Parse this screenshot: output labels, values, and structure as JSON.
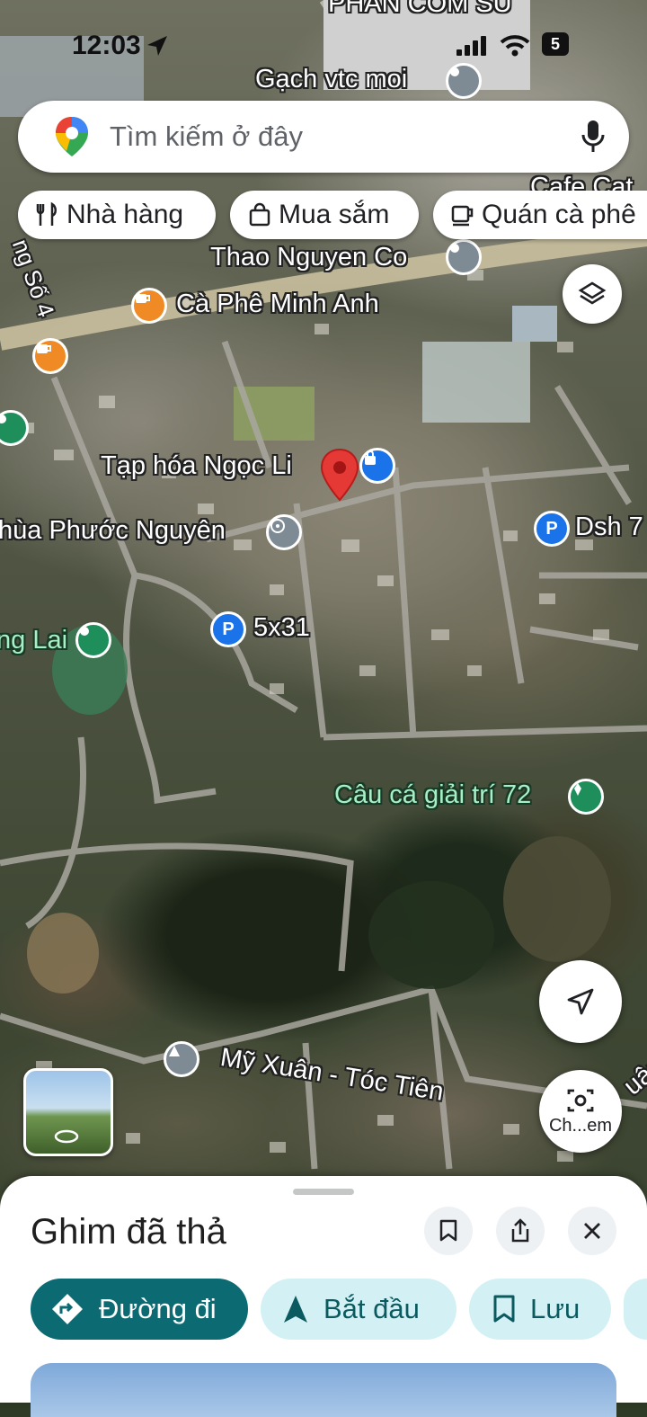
{
  "status_bar": {
    "time": "12:03",
    "battery": "5"
  },
  "search": {
    "placeholder": "Tìm kiếm ở đây"
  },
  "chips": [
    {
      "label": "Nhà hàng",
      "icon": "fork-knife-icon"
    },
    {
      "label": "Mua sắm",
      "icon": "shopping-bag-icon"
    },
    {
      "label": "Quán cà phê",
      "icon": "coffee-icon"
    }
  ],
  "map_labels": {
    "top_factory": "PHAN COM SU",
    "gach": "Gạch vtc moi",
    "cafe_cat": "Cafe Cat",
    "thao": "Thao Nguyen Co",
    "road_left": "ng Số 4",
    "minh_anh": "Cà Phê Minh Anh",
    "tap_hoa": "Tạp hóa Ngọc Li",
    "chua": "hùa Phước Nguyên",
    "dsh": "Dsh 7",
    "parking": "5x31",
    "lai": "ng Lai",
    "cau_ca": "Câu cá giải trí 72",
    "my_xuan": "Mỹ Xuân - Tóc Tiên",
    "road_right": "uân"
  },
  "controls": {
    "camera_label": "Ch...em"
  },
  "sheet": {
    "title": "Ghim đã thả",
    "directions": "Đường đi",
    "start": "Bắt đầu",
    "save": "Lưu"
  },
  "colors": {
    "accent": "#0b57d0",
    "directions_bg": "#0b6a72",
    "chip_bg": "#d3f1f4",
    "pin": "#e53935"
  }
}
